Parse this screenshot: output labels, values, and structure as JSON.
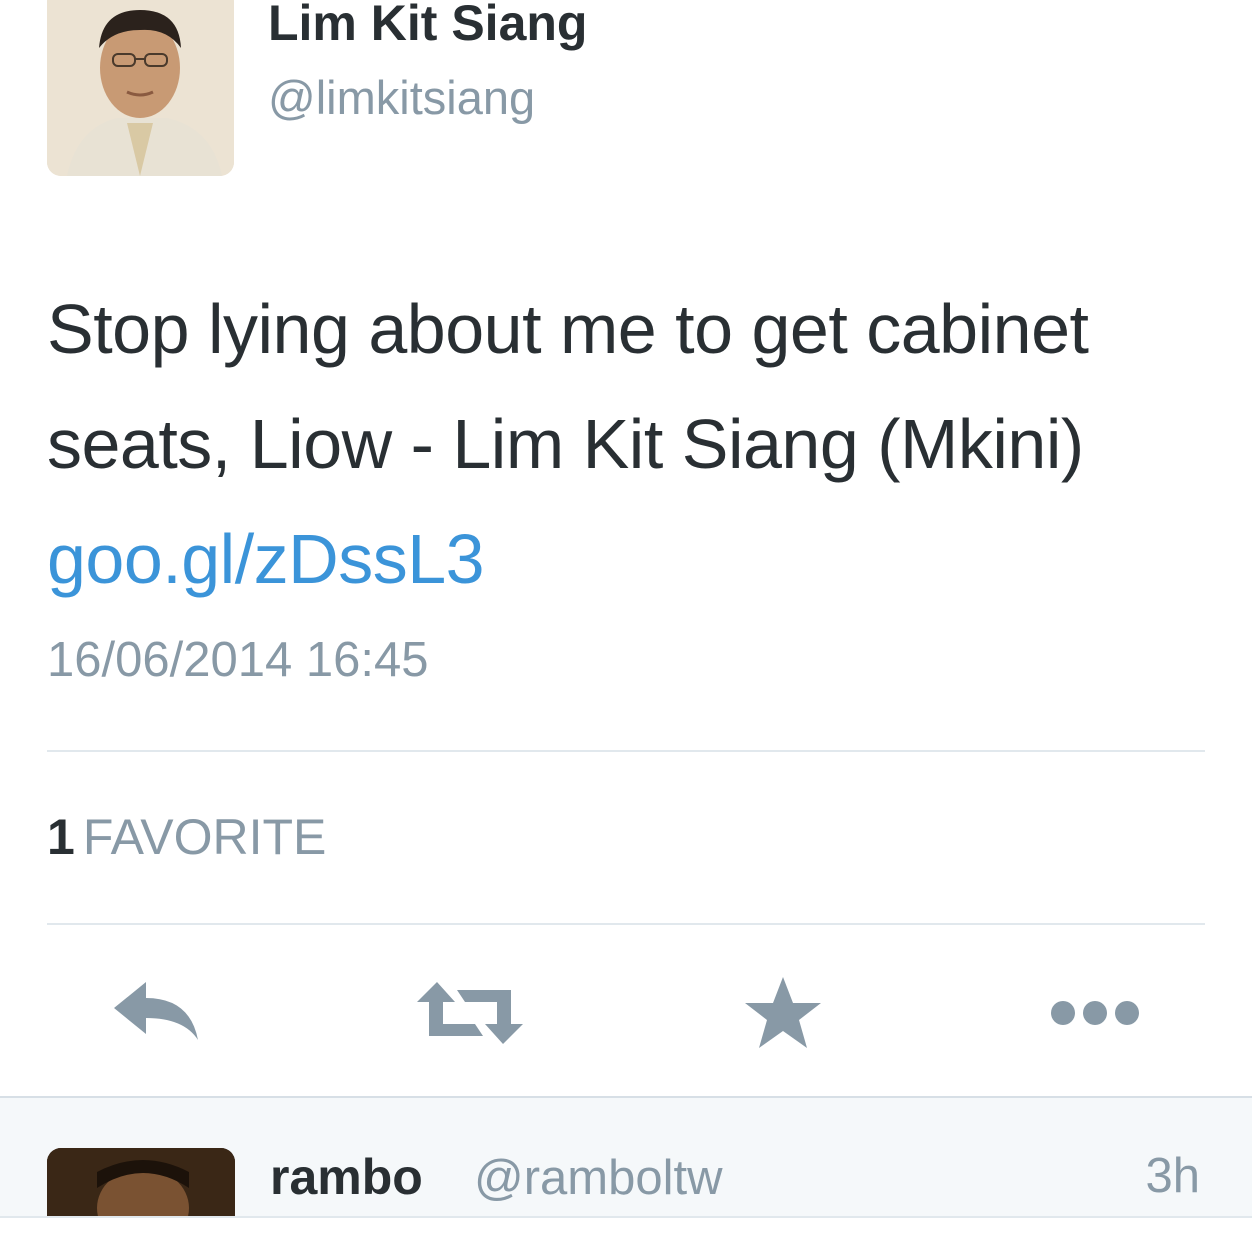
{
  "tweet": {
    "display_name": "Lim Kit Siang",
    "handle": "@limkitsiang",
    "text": "Stop lying about me to get cabinet seats, Liow - Lim Kit Siang (Mkini) ",
    "link_text": "goo.gl/zDssL3",
    "timestamp": "16/06/2014 16:45",
    "favorites_count": "1",
    "favorites_label": "FAVORITE"
  },
  "actions": [
    {
      "name": "reply",
      "icon": "reply-icon"
    },
    {
      "name": "retweet",
      "icon": "retweet-icon"
    },
    {
      "name": "favorite",
      "icon": "star-icon"
    },
    {
      "name": "more",
      "icon": "more-dots-icon"
    }
  ],
  "reply_preview": {
    "display_name": "rambo",
    "handle": "@ramboltw",
    "time": "3h"
  },
  "colors": {
    "text": "#292f33",
    "secondary": "#8899a6",
    "link": "#3b94d9",
    "divider": "#e1e8ed",
    "icon": "#8899a6"
  }
}
